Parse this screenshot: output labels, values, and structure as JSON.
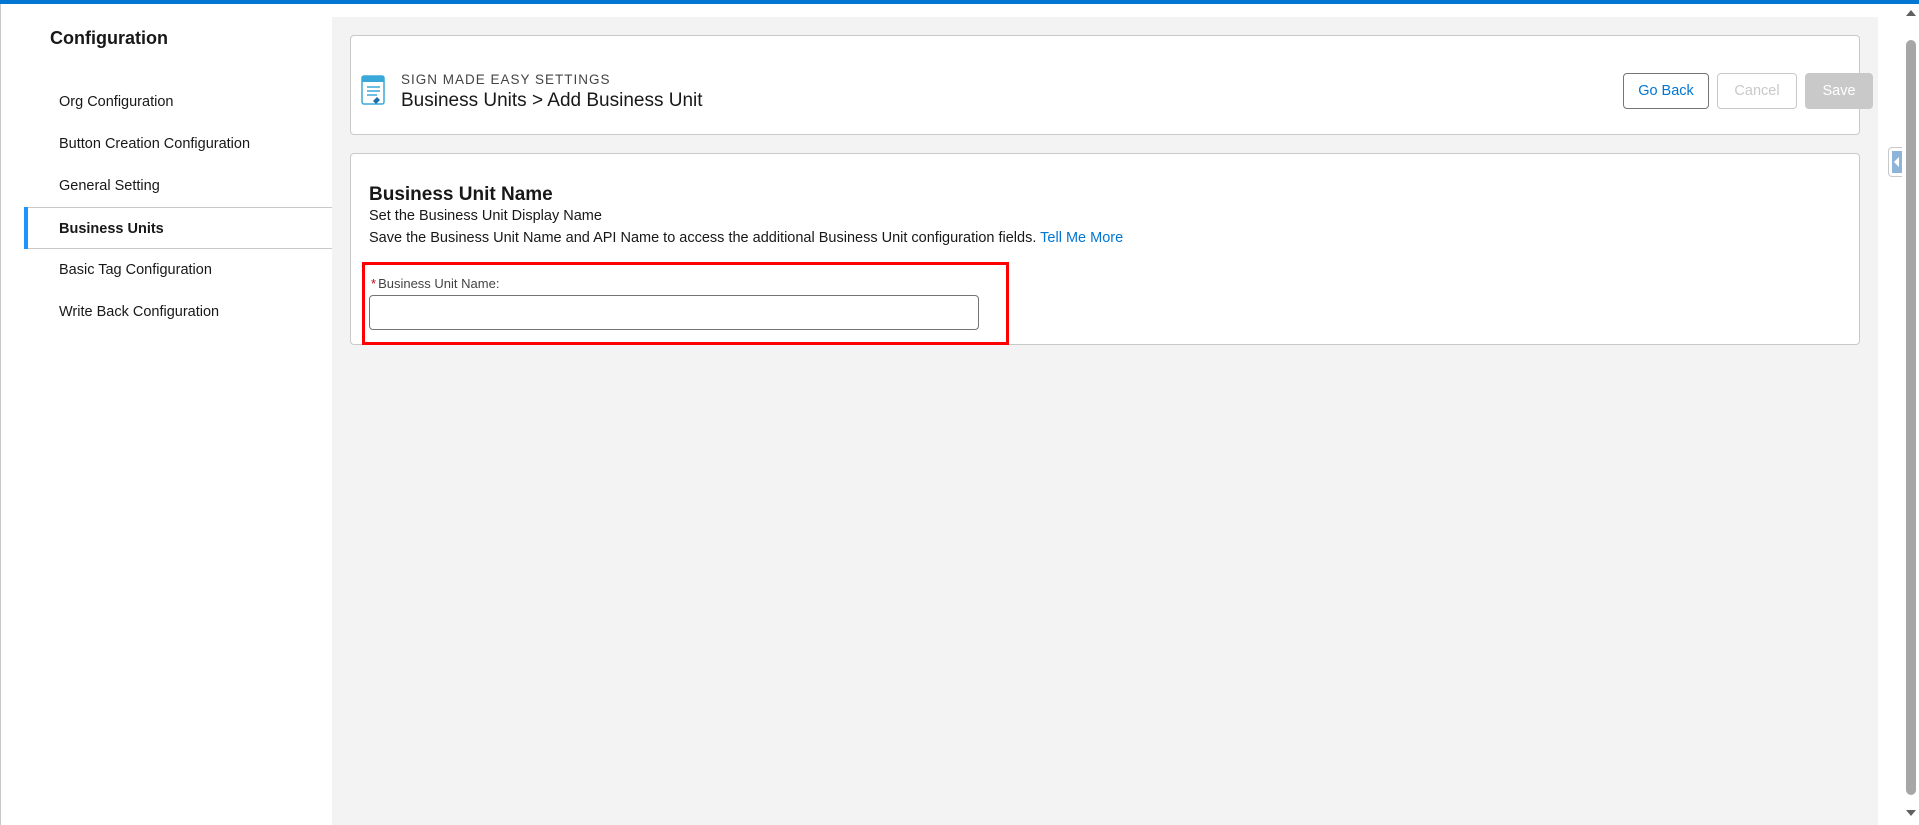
{
  "sidebar": {
    "title": "Configuration",
    "items": [
      {
        "label": "Org Configuration",
        "active": false
      },
      {
        "label": "Button Creation Configuration",
        "active": false
      },
      {
        "label": "General Setting",
        "active": false
      },
      {
        "label": "Business Units",
        "active": true
      },
      {
        "label": "Basic Tag Configuration",
        "active": false
      },
      {
        "label": "Write Back Configuration",
        "active": false
      }
    ]
  },
  "header": {
    "eyebrow": "SIGN MADE EASY SETTINGS",
    "title": "Business Units > Add Business Unit",
    "go_back_label": "Go Back",
    "cancel_label": "Cancel",
    "save_label": "Save"
  },
  "form": {
    "section_title": "Business Unit Name",
    "section_subtitle": "Set the Business Unit Display Name",
    "description": "Save the Business Unit Name and API Name to access the additional Business Unit configuration fields.",
    "link_label": "Tell Me More",
    "field": {
      "required_marker": "*",
      "label": "Business Unit Name:",
      "value": ""
    }
  },
  "colors": {
    "brand_blue": "#0176d3",
    "active_indicator": "#1b96ff",
    "highlight_red": "#ff0000",
    "background": "#f3f3f3"
  },
  "icons": {
    "header_icon": "document-icon",
    "panel_toggle": "chevron-left-icon"
  }
}
